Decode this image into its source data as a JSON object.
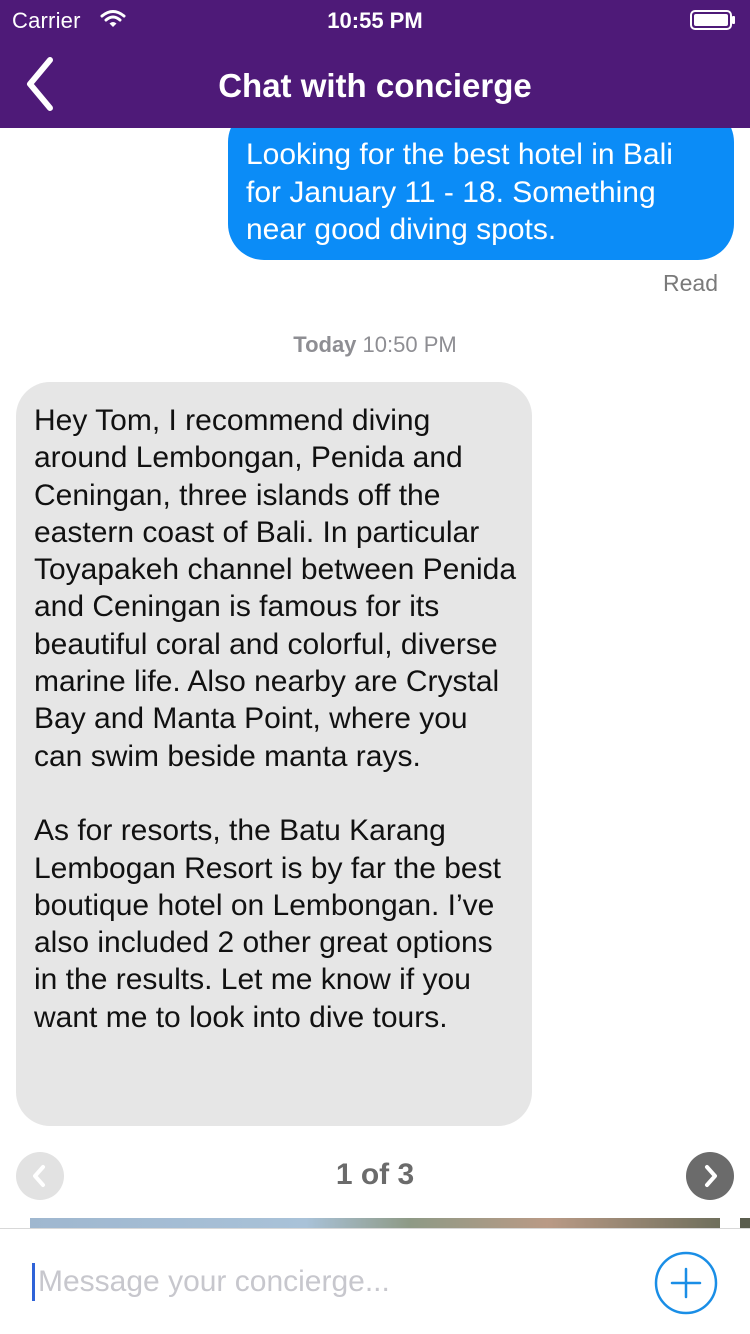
{
  "status_bar": {
    "carrier": "Carrier",
    "time": "10:55 PM"
  },
  "nav": {
    "title": "Chat with concierge",
    "back_icon": "chevron-left-icon"
  },
  "colors": {
    "header_bg": "#4e1a78",
    "outgoing_bubble": "#0b8cf7",
    "incoming_bubble": "#e6e6e6",
    "accent": "#1a8ee6"
  },
  "messages": [
    {
      "direction": "outgoing",
      "text": "Looking for the best hotel in Bali for January 11 - 18. Something near good diving spots.",
      "receipt": "Read"
    },
    {
      "direction": "incoming",
      "text": "Hey Tom, I recommend diving around Lembongan, Penida and Ceningan, three islands off the eastern coast of Bali. In particular Toyapakeh channel between Penida and Ceningan is famous for its beautiful coral and colorful, diverse marine life. Also nearby are Crystal Bay and Manta Point, where you can swim beside manta rays.\n\nAs for resorts, the Batu Karang Lembogan Resort is by far the best boutique hotel on Lembongan. I’ve also included 2 other great options in the results. Let me know if you want me to look into dive tours."
    }
  ],
  "timestamp": {
    "day": "Today",
    "time": "10:50 PM"
  },
  "pager": {
    "label": "1 of 3",
    "prev_icon": "chevron-left-icon",
    "next_icon": "chevron-right-icon"
  },
  "composer": {
    "placeholder": "Message your concierge...",
    "value": "",
    "add_icon": "plus-circle-icon"
  }
}
